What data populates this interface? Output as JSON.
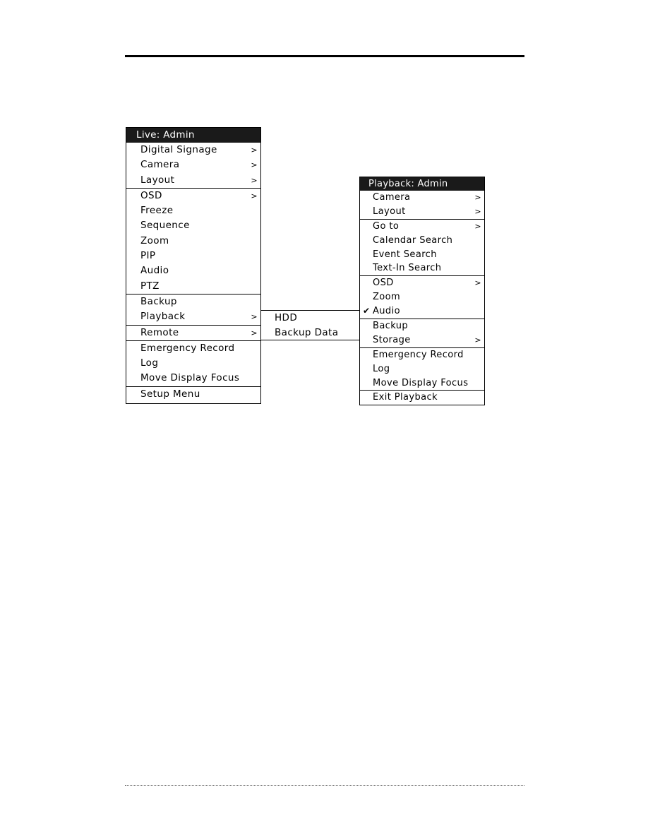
{
  "live_menu": {
    "title": "Live: Admin",
    "sections": [
      [
        {
          "label": "Digital Signage",
          "submenu": true
        },
        {
          "label": "Camera",
          "submenu": true
        },
        {
          "label": "Layout",
          "submenu": true
        }
      ],
      [
        {
          "label": "OSD",
          "submenu": true
        },
        {
          "label": "Freeze",
          "submenu": false
        },
        {
          "label": "Sequence",
          "submenu": false
        },
        {
          "label": "Zoom",
          "submenu": false
        },
        {
          "label": "PIP",
          "submenu": false
        },
        {
          "label": "Audio",
          "submenu": false
        },
        {
          "label": "PTZ",
          "submenu": false
        }
      ],
      [
        {
          "label": "Backup",
          "submenu": false
        },
        {
          "label": "Playback",
          "submenu": true
        }
      ],
      [
        {
          "label": "Remote",
          "submenu": true
        }
      ],
      [
        {
          "label": "Emergency Record",
          "submenu": false
        },
        {
          "label": "Log",
          "submenu": false
        },
        {
          "label": "Move Display Focus",
          "submenu": false
        }
      ],
      [
        {
          "label": "Setup Menu",
          "submenu": false
        }
      ]
    ]
  },
  "playback_submenu": {
    "items": [
      {
        "label": "HDD"
      },
      {
        "label": "Backup Data"
      }
    ]
  },
  "playback_menu": {
    "title": "Playback: Admin",
    "sections": [
      [
        {
          "label": "Camera",
          "submenu": true
        },
        {
          "label": "Layout",
          "submenu": true
        }
      ],
      [
        {
          "label": "Go to",
          "submenu": true
        },
        {
          "label": "Calendar Search",
          "submenu": false
        },
        {
          "label": "Event Search",
          "submenu": false
        },
        {
          "label": "Text-In Search",
          "submenu": false
        }
      ],
      [
        {
          "label": "OSD",
          "submenu": true
        },
        {
          "label": "Zoom",
          "submenu": false
        },
        {
          "label": "Audio",
          "submenu": false,
          "checked": true
        }
      ],
      [
        {
          "label": "Backup",
          "submenu": false
        },
        {
          "label": "Storage",
          "submenu": true
        }
      ],
      [
        {
          "label": "Emergency Record",
          "submenu": false
        },
        {
          "label": "Log",
          "submenu": false
        },
        {
          "label": "Move Display Focus",
          "submenu": false
        }
      ],
      [
        {
          "label": "Exit Playback",
          "submenu": false
        }
      ]
    ]
  },
  "icons": {
    "submenu_arrow": ">",
    "check_mark": "✔"
  }
}
